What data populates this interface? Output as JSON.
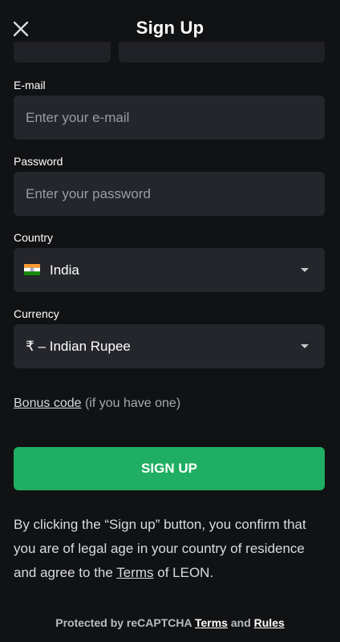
{
  "header": {
    "title": "Sign Up",
    "close_icon": "close-icon"
  },
  "form": {
    "email": {
      "label": "E-mail",
      "placeholder": "Enter your e-mail",
      "value": ""
    },
    "password": {
      "label": "Password",
      "placeholder": "Enter your password",
      "value": ""
    },
    "country": {
      "label": "Country",
      "value": "India",
      "flag_icon": "india-flag-icon"
    },
    "currency": {
      "label": "Currency",
      "value": "₹ – Indian Rupee"
    },
    "bonus": {
      "link": "Bonus code",
      "note": "(if you have one)"
    },
    "submit_label": "SIGN UP"
  },
  "disclaimer": {
    "prefix": "By clicking the “Sign up” button, you confirm that you are of legal age in your country of residence and agree to the ",
    "terms_link": "Terms",
    "suffix": " of LEON."
  },
  "recaptcha": {
    "prefix": "Protected by reCAPTCHA ",
    "terms_link": "Terms",
    "and": " and ",
    "rules_link": "Rules"
  },
  "colors": {
    "background": "#111214",
    "field_background": "#24262b",
    "accent": "#1fae62"
  }
}
